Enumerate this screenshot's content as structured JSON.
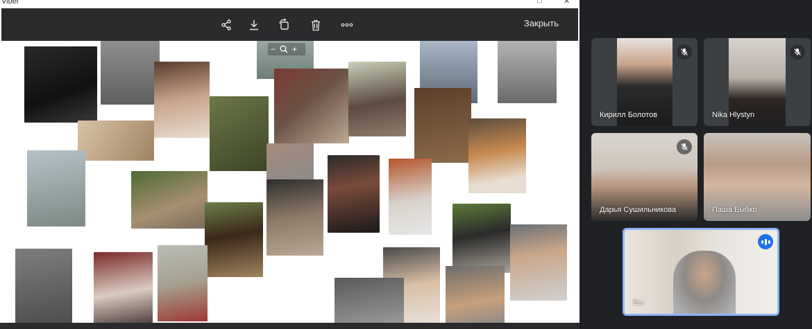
{
  "viber": {
    "title": "Viber",
    "toolbar": {
      "share_icon": "share-icon",
      "download_icon": "download-icon",
      "rotate_icon": "rotate-icon",
      "delete_icon": "trash-icon",
      "more_icon": "more-icon",
      "close_label": "Закрыть"
    },
    "zoom": {
      "minus": "−",
      "plus": "+"
    }
  },
  "participants": [
    {
      "name": "Кирилл Болотов",
      "muted": true
    },
    {
      "name": "Nika Hlystyn",
      "muted": true
    },
    {
      "name": "Дарья Сушильникова",
      "muted": true
    },
    {
      "name": "Паша Быбко",
      "muted": false
    },
    {
      "name": "Вы",
      "speaking": true
    }
  ],
  "colors": {
    "meet_bg": "#202124",
    "tile_bg": "#3c4043",
    "active_border": "#8ab4f8",
    "speaking_badge": "#1a73e8",
    "toolbar_bg": "#2b2b2e"
  }
}
